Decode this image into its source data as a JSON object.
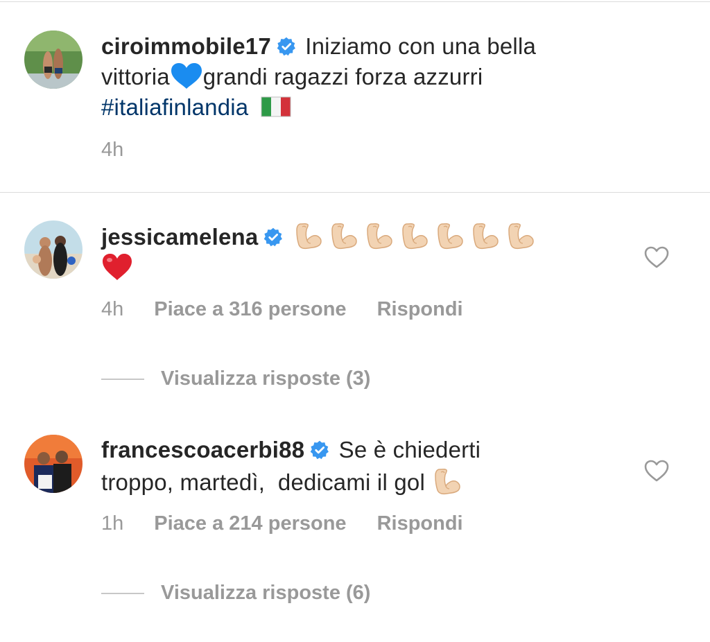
{
  "caption": {
    "username": "ciroimmobile17",
    "text_1": "Iniziamo con una bella",
    "text_2": "vittoria",
    "text_3": "grandi ragazzi forza azzurri",
    "hashtag": "#italiafinlandia",
    "time": "4h"
  },
  "comments": [
    {
      "username": "jessicamelena",
      "time": "4h",
      "likes": "Piace a 316 persone",
      "reply": "Rispondi",
      "view_replies": "Visualizza risposte (3)"
    },
    {
      "username": "francescoacerbi88",
      "text_1": "Se è chiederti",
      "text_2": "troppo, martedì,  dedicami il gol",
      "time": "1h",
      "likes": "Piace a 214 persone",
      "reply": "Rispondi",
      "view_replies": "Visualizza risposte (6)"
    }
  ],
  "icons": {
    "verified": "verified-badge-icon",
    "heart": "heart-outline-icon",
    "emoji_blue_heart": "blue-heart-emoji",
    "emoji_flag": "italy-flag-emoji",
    "emoji_muscle": "flexed-biceps-emoji",
    "emoji_red_heart": "red-heart-emoji"
  },
  "colors": {
    "text": "#262626",
    "meta": "#999999",
    "hashtag": "#003569",
    "verified": "#3897f0",
    "divider": "#dbdbdb"
  }
}
